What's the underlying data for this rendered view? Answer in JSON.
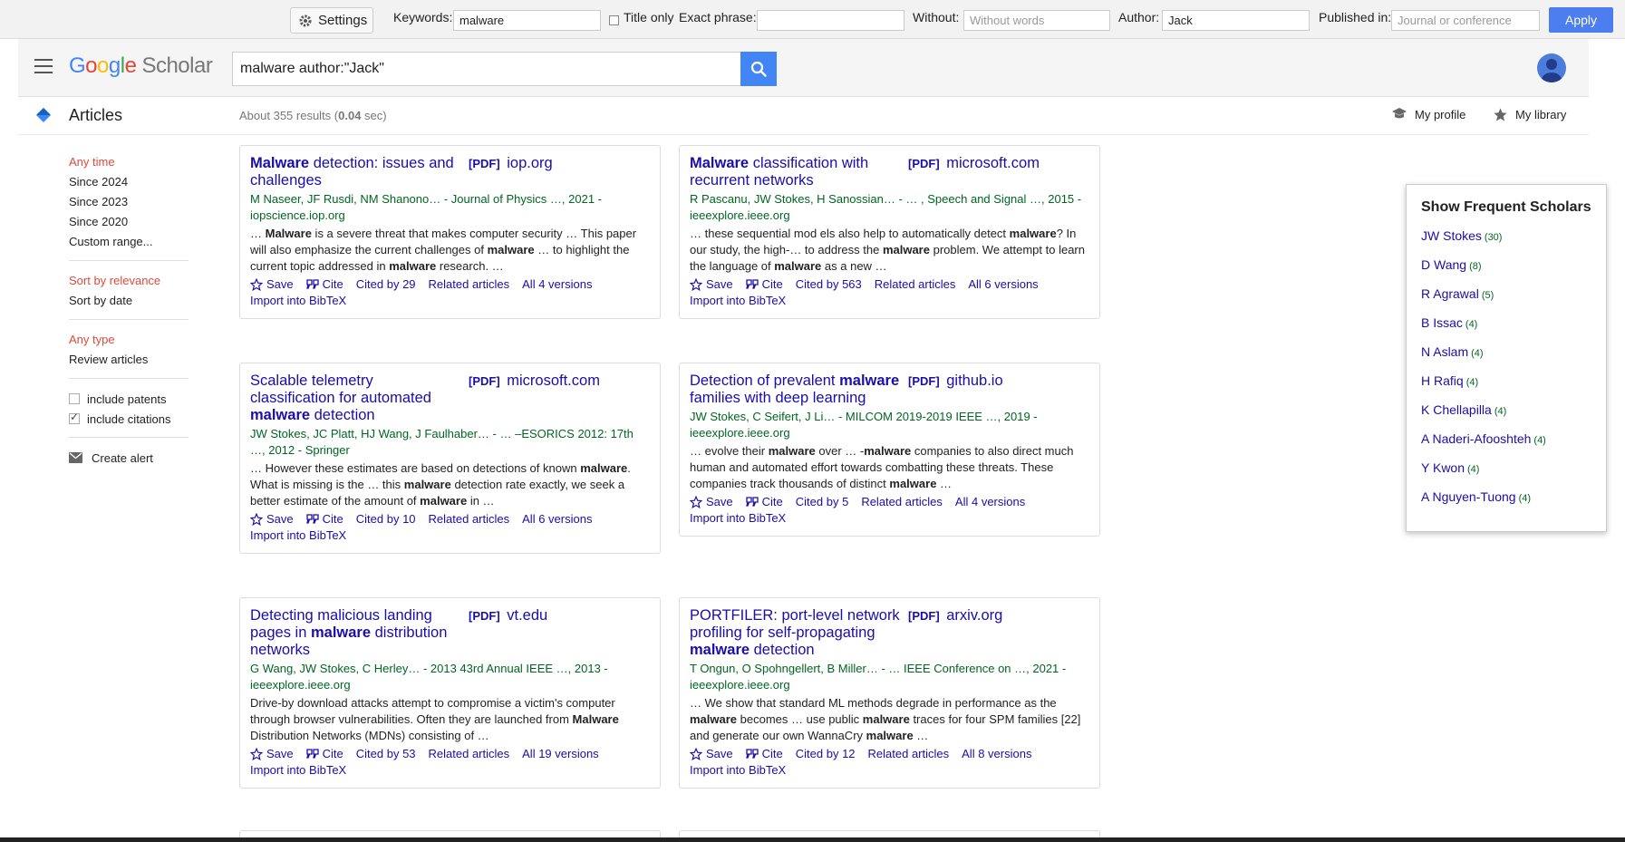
{
  "filterbar": {
    "settings_label": "Settings",
    "keywords_label": "Keywords:",
    "keywords_value": "malware",
    "title_only_label": "Title only",
    "exact_phrase_label": "Exact phrase:",
    "exact_phrase_value": "",
    "without_label": "Without:",
    "without_placeholder": "Without words",
    "author_label": "Author:",
    "author_value": "Jack",
    "published_label": "Published in:",
    "published_placeholder": "Journal or conference",
    "apply_label": "Apply"
  },
  "header": {
    "logo_g": "G",
    "logo_o1": "o",
    "logo_o2": "o",
    "logo_g2": "g",
    "logo_l": "l",
    "logo_e": "e",
    "logo_scholar": "Scholar",
    "search_value": "malware author:\"Jack\""
  },
  "subheader": {
    "articles_label": "Articles",
    "stats_prefix": "About 355 results (",
    "stats_time": "0.04",
    "stats_suffix": " sec)",
    "my_profile": "My profile",
    "my_library": "My library"
  },
  "sidebar": {
    "time_filters": [
      "Any time",
      "Since 2024",
      "Since 2023",
      "Since 2020",
      "Custom range..."
    ],
    "sort_options": [
      "Sort by relevance",
      "Sort by date"
    ],
    "type_options": [
      "Any type",
      "Review articles"
    ],
    "include_patents": "include patents",
    "include_citations": "include citations",
    "create_alert": "Create alert"
  },
  "results": [
    {
      "title_pre": "",
      "title_bold": "Malware",
      "title_post": " detection: issues and challenges",
      "pdf_tag": "[PDF]",
      "pdf_source": "iop.org",
      "authors": "M Naseer, JF Rusdi, NM Shanono… - Journal of Physics …, 2021 - iopscience.iop.org",
      "snippet": "… Malware is a severe threat that makes computer security … This paper will also emphasize the current challenges of malware … to highlight the current topic addressed in malware research. …",
      "save": "Save",
      "cite": "Cite",
      "cited_by": "Cited by 29",
      "related": "Related articles",
      "versions": "All 4 versions",
      "bibtex": "Import into BibTeX"
    },
    {
      "title_pre": "",
      "title_bold": "Malware",
      "title_post": " classification with recurrent networks",
      "pdf_tag": "[PDF]",
      "pdf_source": "microsoft.com",
      "authors": "R Pascanu, JW Stokes, H Sanossian… - … , Speech and Signal …, 2015 - ieeexplore.ieee.org",
      "snippet": "… these sequential mod els also help to automatically detect malware? In our study, the high-… to address the malware problem. We attempt to learn the language of malware as a new …",
      "save": "Save",
      "cite": "Cite",
      "cited_by": "Cited by 563",
      "related": "Related articles",
      "versions": "All 6 versions",
      "bibtex": "Import into BibTeX"
    },
    {
      "title_pre": "Scalable telemetry classification for automated ",
      "title_bold": "malware",
      "title_post": " detection",
      "pdf_tag": "[PDF]",
      "pdf_source": "microsoft.com",
      "authors": "JW Stokes, JC Platt, HJ Wang, J Faulhaber… - … –ESORICS 2012: 17th …, 2012 - Springer",
      "snippet": "… However these estimates are based on detections of known malware. What is missing is the … this malware detection rate exactly, we seek a better estimate of the amount of malware in …",
      "save": "Save",
      "cite": "Cite",
      "cited_by": "Cited by 10",
      "related": "Related articles",
      "versions": "All 6 versions",
      "bibtex": "Import into BibTeX"
    },
    {
      "title_pre": "Detection of prevalent ",
      "title_bold": "malware",
      "title_post": " families with deep learning",
      "pdf_tag": "[PDF]",
      "pdf_source": "github.io",
      "authors": "JW Stokes, C Seifert, J Li… - MILCOM 2019-2019 IEEE …, 2019 - ieeexplore.ieee.org",
      "snippet": "… evolve their malware over … -malware companies to also direct much human and automated effort towards combatting these threats. These companies track thousands of distinct malware …",
      "save": "Save",
      "cite": "Cite",
      "cited_by": "Cited by 5",
      "related": "Related articles",
      "versions": "All 4 versions",
      "bibtex": "Import into BibTeX"
    },
    {
      "title_pre": "Detecting malicious landing pages in ",
      "title_bold": "malware",
      "title_post": " distribution networks",
      "pdf_tag": "[PDF]",
      "pdf_source": "vt.edu",
      "authors": "G Wang, JW Stokes, C Herley… - 2013 43rd Annual IEEE …, 2013 - ieeexplore.ieee.org",
      "snippet": "Drive-by download attacks attempt to compromise a victim's computer through browser vulnerabilities. Often they are launched from Malware Distribution Networks (MDNs) consisting of …",
      "save": "Save",
      "cite": "Cite",
      "cited_by": "Cited by 53",
      "related": "Related articles",
      "versions": "All 19 versions",
      "bibtex": "Import into BibTeX"
    },
    {
      "title_pre": "PORTFILER: port-level network profiling for self-propagating ",
      "title_bold": "malware",
      "title_post": " detection",
      "pdf_tag": "[PDF]",
      "pdf_source": "arxiv.org",
      "authors": "T Ongun, O Spohngellert, B Miller… - … IEEE Conference on …, 2021 - ieeexplore.ieee.org",
      "snippet": "… We show that standard ML methods degrade in performance as the malware becomes … use public malware traces for four SPM families [22] and generate our own WannaCry malware …",
      "save": "Save",
      "cite": "Cite",
      "cited_by": "Cited by 12",
      "related": "Related articles",
      "versions": "All 8 versions",
      "bibtex": "Import into BibTeX"
    }
  ],
  "scholars": {
    "heading": "Show Frequent Scholars",
    "items": [
      {
        "name": "JW Stokes",
        "count": "(30)"
      },
      {
        "name": "D Wang",
        "count": "(8)"
      },
      {
        "name": "R Agrawal",
        "count": "(5)"
      },
      {
        "name": "B Issac",
        "count": "(4)"
      },
      {
        "name": "N Aslam",
        "count": "(4)"
      },
      {
        "name": "H Rafiq",
        "count": "(4)"
      },
      {
        "name": "K Chellapilla",
        "count": "(4)"
      },
      {
        "name": "A Naderi-Afooshteh",
        "count": "(4)"
      },
      {
        "name": "Y Kwon",
        "count": "(4)"
      },
      {
        "name": "A Nguyen-Tuong",
        "count": "(4)"
      }
    ]
  },
  "colors": {
    "accent": "#4285f4",
    "link": "#1a0dab",
    "author_green": "#006621",
    "active_filter": "#dd4b39",
    "apply_button": "#4d7ef0"
  }
}
